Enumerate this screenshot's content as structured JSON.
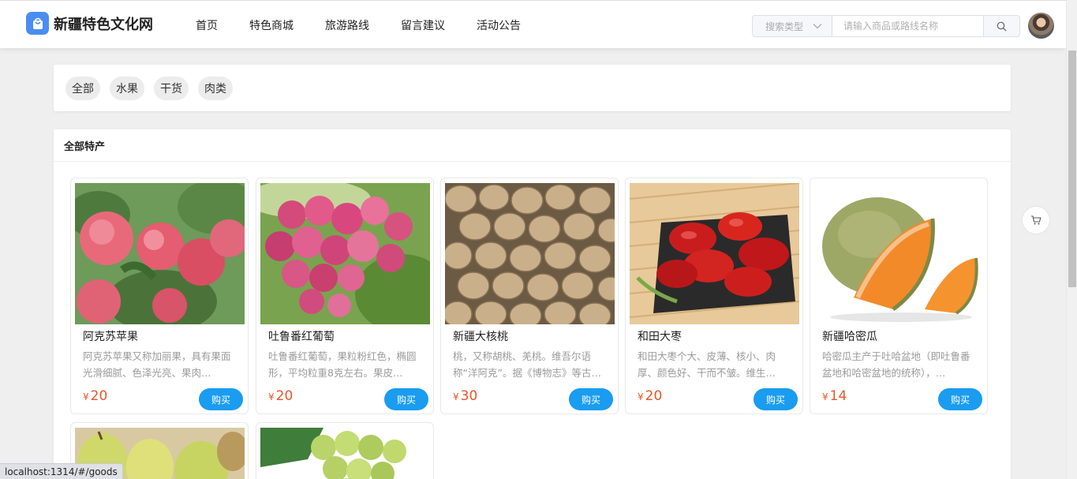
{
  "header": {
    "logo_text": "新疆特色文化网",
    "nav": [
      "首页",
      "特色商城",
      "旅游路线",
      "留言建议",
      "活动公告"
    ],
    "search_type_label": "搜索类型",
    "search_placeholder": "请输入商品或路线名称"
  },
  "categories": [
    "全部",
    "水果",
    "干货",
    "肉类"
  ],
  "section_title": "全部特产",
  "buy_label": "购买",
  "currency_symbol": "¥",
  "products": [
    {
      "name": "阿克苏苹果",
      "desc": "阿克苏苹果又称加丽果，具有果面光滑细腻、色泽光亮、果肉…",
      "price": "20"
    },
    {
      "name": "吐鲁番红葡萄",
      "desc": "吐鲁番红葡萄，果粒粉红色，椭圆形，平均粒重8克左右。果皮…",
      "price": "20"
    },
    {
      "name": "新疆大核桃",
      "desc": "桃，又称胡桃、羌桃。维吾尔语称“洋阿克”。据《博物志》等古…",
      "price": "30"
    },
    {
      "name": "和田大枣",
      "desc": "和田大枣个大、皮薄、核小、肉厚、颜色好、干而不皱。维生…",
      "price": "20"
    },
    {
      "name": "新疆哈密瓜",
      "desc": "哈密瓜主产于吐哈盆地（即吐鲁番盆地和哈密盆地的统称），…",
      "price": "14"
    }
  ],
  "status_url": "localhost:1314/#/goods",
  "colors": {
    "accent": "#1a9cf0",
    "price": "#e8562a",
    "logo": "#4a8df0"
  }
}
